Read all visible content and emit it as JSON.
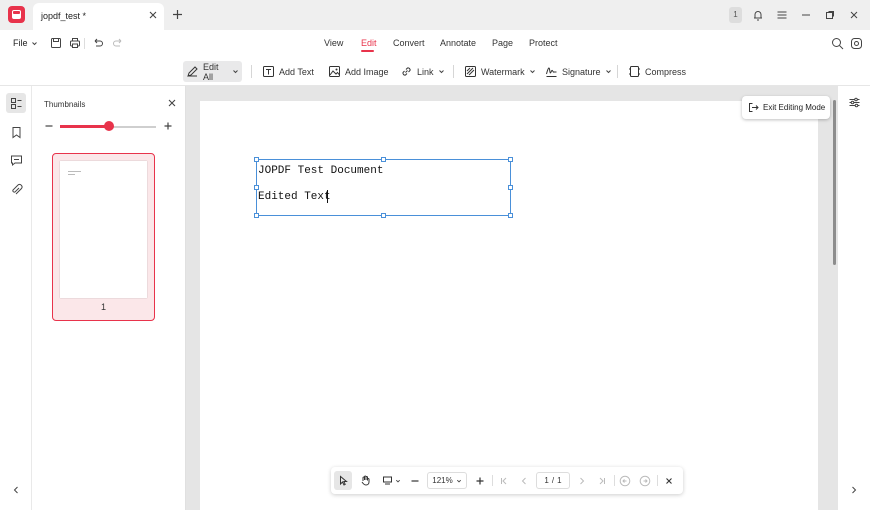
{
  "titlebar": {
    "tab_title": "jopdf_test *",
    "notification_count": "1"
  },
  "menubar": {
    "file_label": "File",
    "tabs": [
      "View",
      "Edit",
      "Convert",
      "Annotate",
      "Page",
      "Protect"
    ],
    "active_tab": "Edit"
  },
  "toolbar": {
    "edit_all": "Edit All",
    "add_text": "Add Text",
    "add_image": "Add Image",
    "link": "Link",
    "watermark": "Watermark",
    "signature": "Signature",
    "compress": "Compress"
  },
  "thumbnails": {
    "title": "Thumbnails",
    "zoom_level_fraction": 0.5,
    "pages": [
      {
        "number": "1"
      }
    ]
  },
  "document": {
    "line1": "JOPDF Test Document",
    "line2": "Edited Text"
  },
  "exit_editing": "Exit Editing Mode",
  "bottom_bar": {
    "zoom": "121%",
    "page_current": "1",
    "page_total": "1",
    "page_separator": "/"
  },
  "colors": {
    "accent": "#e8334b",
    "selection": "#4a90d9"
  }
}
